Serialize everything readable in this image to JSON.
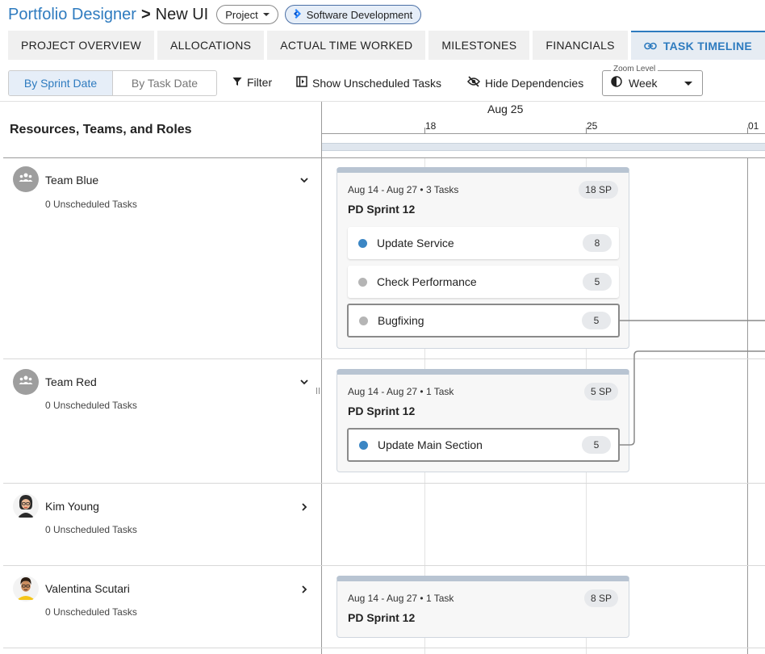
{
  "header": {
    "breadcrumb_root": "Portfolio Designer",
    "breadcrumb_sep": ">",
    "breadcrumb_current": "New UI",
    "project_pill": "Project",
    "category_pill": "Software Development"
  },
  "tabs": [
    {
      "label": "PROJECT OVERVIEW"
    },
    {
      "label": "ALLOCATIONS"
    },
    {
      "label": "ACTUAL TIME WORKED"
    },
    {
      "label": "MILESTONES"
    },
    {
      "label": "FINANCIALS"
    },
    {
      "label": "TASK TIMELINE",
      "active": true
    }
  ],
  "toolbar": {
    "by_sprint": "By Sprint Date",
    "by_task": "By Task Date",
    "filter": "Filter",
    "show_unscheduled": "Show Unscheduled Tasks",
    "hide_dependencies": "Hide Dependencies",
    "zoom_label": "Zoom Level",
    "zoom_value": "Week"
  },
  "left_header": "Resources, Teams, and Roles",
  "timeline": {
    "month": "Aug 25",
    "days": [
      "18",
      "25",
      "01"
    ]
  },
  "resources": [
    {
      "name": "Team Blue",
      "sub": "0 Unscheduled Tasks",
      "type": "team",
      "expanded": true
    },
    {
      "name": "Team Red",
      "sub": "0 Unscheduled Tasks",
      "type": "team",
      "expanded": true
    },
    {
      "name": "Kim Young",
      "sub": "0 Unscheduled Tasks",
      "type": "person",
      "expanded": false
    },
    {
      "name": "Valentina Scutari",
      "sub": "0 Unscheduled Tasks",
      "type": "person",
      "expanded": false
    }
  ],
  "sprints": [
    {
      "dates": "Aug 14 - Aug 27 • 3 Tasks",
      "title": "PD Sprint 12",
      "points": "18 SP",
      "tasks": [
        {
          "name": "Update Service",
          "points": "8",
          "status_color": "#3b86c4"
        },
        {
          "name": "Check Performance",
          "points": "5",
          "status_color": "#b5b5b5"
        },
        {
          "name": "Bugfixing",
          "points": "5",
          "status_color": "#b5b5b5"
        }
      ]
    },
    {
      "dates": "Aug 14 - Aug 27 • 1 Task",
      "title": "PD Sprint 12",
      "points": "5 SP",
      "tasks": [
        {
          "name": "Update Main Section",
          "points": "5",
          "status_color": "#3b86c4"
        }
      ]
    },
    {
      "dates": "Aug 14 - Aug 27 • 1 Task",
      "title": "PD Sprint 12",
      "points": "8 SP",
      "tasks": []
    }
  ],
  "colors": {
    "accent": "#2e7bbf",
    "card_bar": "#b8c4d2"
  }
}
